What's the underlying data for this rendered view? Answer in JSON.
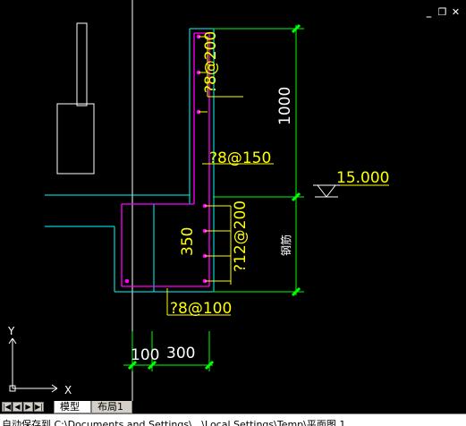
{
  "window_buttons": {
    "minimize": "_",
    "restore": "❐",
    "close": "✕"
  },
  "annotations": {
    "rebar_top": "?8@200",
    "rebar_wall": "?8@150",
    "rebar_bottom_vertical": "?12@200",
    "rebar_bottom": "?8@100",
    "dim_height": "1000",
    "dim_350": "350",
    "dim_100": "100",
    "dim_300": "300",
    "elevation": "15.000",
    "side_label": "钢筋"
  },
  "ucs": {
    "x_label": "X",
    "y_label": "Y"
  },
  "tabs": {
    "nav": [
      "|◀",
      "◀",
      "▶",
      "▶|"
    ],
    "model": "模型",
    "layout1": "布局1"
  },
  "command_line": "自动保存到 C:\\Documents and Settings\\...\\Local Settings\\Temp\\平面图 1 ..."
}
